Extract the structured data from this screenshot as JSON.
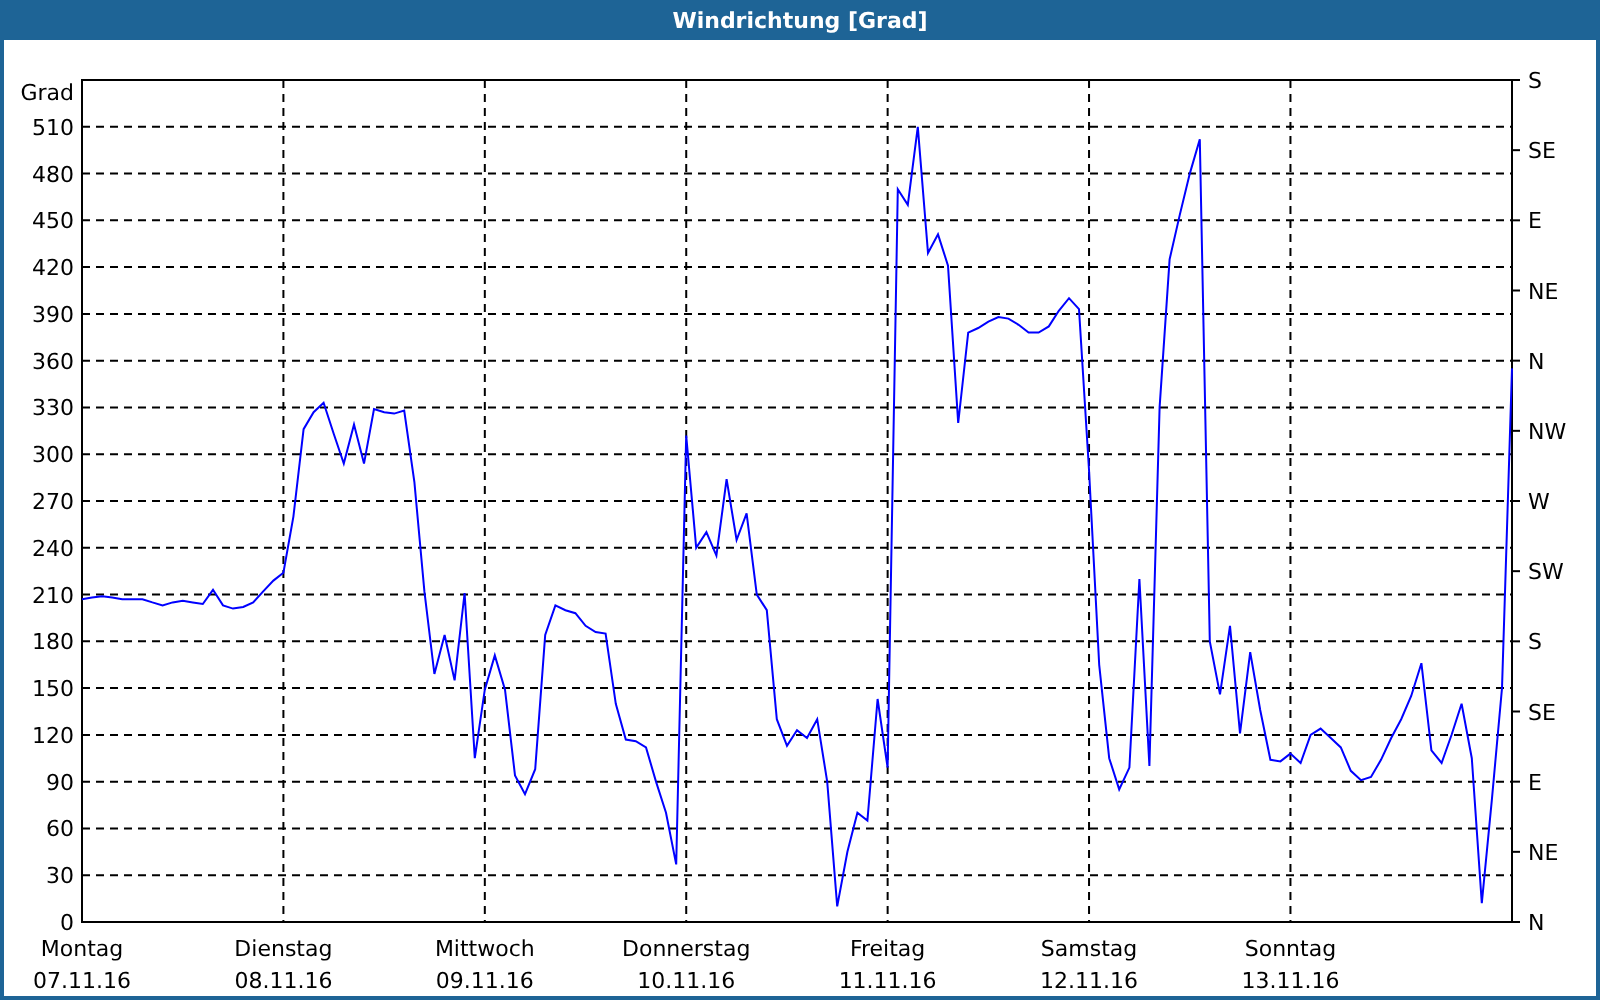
{
  "window": {
    "title": "Windrichtung [Grad]"
  },
  "chart": {
    "chart_data": {
      "type": "line",
      "grid": true,
      "ylabel": "Grad",
      "ylim": [
        0,
        540
      ],
      "yticks": [
        0,
        30,
        60,
        90,
        120,
        150,
        180,
        210,
        240,
        270,
        300,
        330,
        360,
        390,
        420,
        450,
        480,
        510
      ],
      "categories": [
        "Montag\n07.11.16",
        null,
        null,
        null,
        null,
        null,
        null,
        null,
        null,
        null,
        null,
        null,
        null,
        null,
        null,
        null,
        null,
        null,
        null,
        null,
        "Dienstag\n08.11.16",
        null,
        null,
        null,
        null,
        null,
        null,
        null,
        null,
        null,
        null,
        null,
        null,
        null,
        null,
        null,
        null,
        null,
        null,
        null,
        "Mittwoch\n09.11.16",
        null,
        null,
        null,
        null,
        null,
        null,
        null,
        null,
        null,
        null,
        null,
        null,
        null,
        null,
        null,
        null,
        null,
        null,
        null,
        "Donnerstag\n10.11.16",
        null,
        null,
        null,
        null,
        null,
        null,
        null,
        null,
        null,
        null,
        null,
        null,
        null,
        null,
        null,
        null,
        null,
        null,
        null,
        "Freitag\n11.11.16",
        null,
        null,
        null,
        null,
        null,
        null,
        null,
        null,
        null,
        null,
        null,
        null,
        null,
        null,
        null,
        null,
        null,
        null,
        null,
        "Samstag\n12.11.16",
        null,
        null,
        null,
        null,
        null,
        null,
        null,
        null,
        null,
        null,
        null,
        null,
        null,
        null,
        null,
        null,
        null,
        null,
        null,
        "Sonntag\n13.11.16",
        null,
        null,
        null,
        null,
        null,
        null,
        null,
        null,
        null,
        null,
        null,
        null,
        null,
        null,
        null,
        null,
        null,
        null,
        null,
        null,
        null,
        null
      ],
      "series": [
        {
          "color": "#0000ff",
          "values": [
            207,
            208,
            209,
            208,
            207,
            207,
            207,
            205,
            203,
            205,
            206,
            205,
            204,
            213,
            203,
            201,
            202,
            205,
            212,
            219,
            224,
            260,
            316,
            327,
            333,
            313,
            294,
            319,
            294,
            329,
            327,
            326,
            328,
            282,
            212,
            159,
            184,
            155,
            211,
            105,
            149,
            171,
            149,
            94,
            82,
            98,
            184,
            203,
            200,
            198,
            190,
            186,
            185,
            140,
            117,
            116,
            112,
            90,
            70,
            37,
            312,
            240,
            250,
            235,
            284,
            245,
            262,
            210,
            200,
            130,
            113,
            123,
            118,
            130,
            90,
            10,
            45,
            70,
            65,
            143,
            99,
            470,
            460,
            510,
            429,
            441,
            421,
            320,
            378,
            381,
            385,
            388,
            387,
            383,
            378,
            378,
            382,
            392,
            400,
            393,
            290,
            165,
            105,
            85,
            99,
            220,
            100,
            330,
            425,
            453,
            480,
            502,
            180,
            146,
            190,
            121,
            173,
            136,
            104,
            103,
            108,
            102,
            120,
            124,
            118,
            112,
            97,
            91,
            93,
            104,
            118,
            130,
            145,
            166,
            110,
            102,
            120,
            140,
            105,
            12,
            78,
            150,
            355
          ]
        }
      ]
    },
    "direction_labels": [
      "S",
      "SE",
      "E",
      "NE",
      "N",
      "NW",
      "W",
      "SW",
      "S",
      "SE",
      "E",
      "NE",
      "N"
    ]
  }
}
